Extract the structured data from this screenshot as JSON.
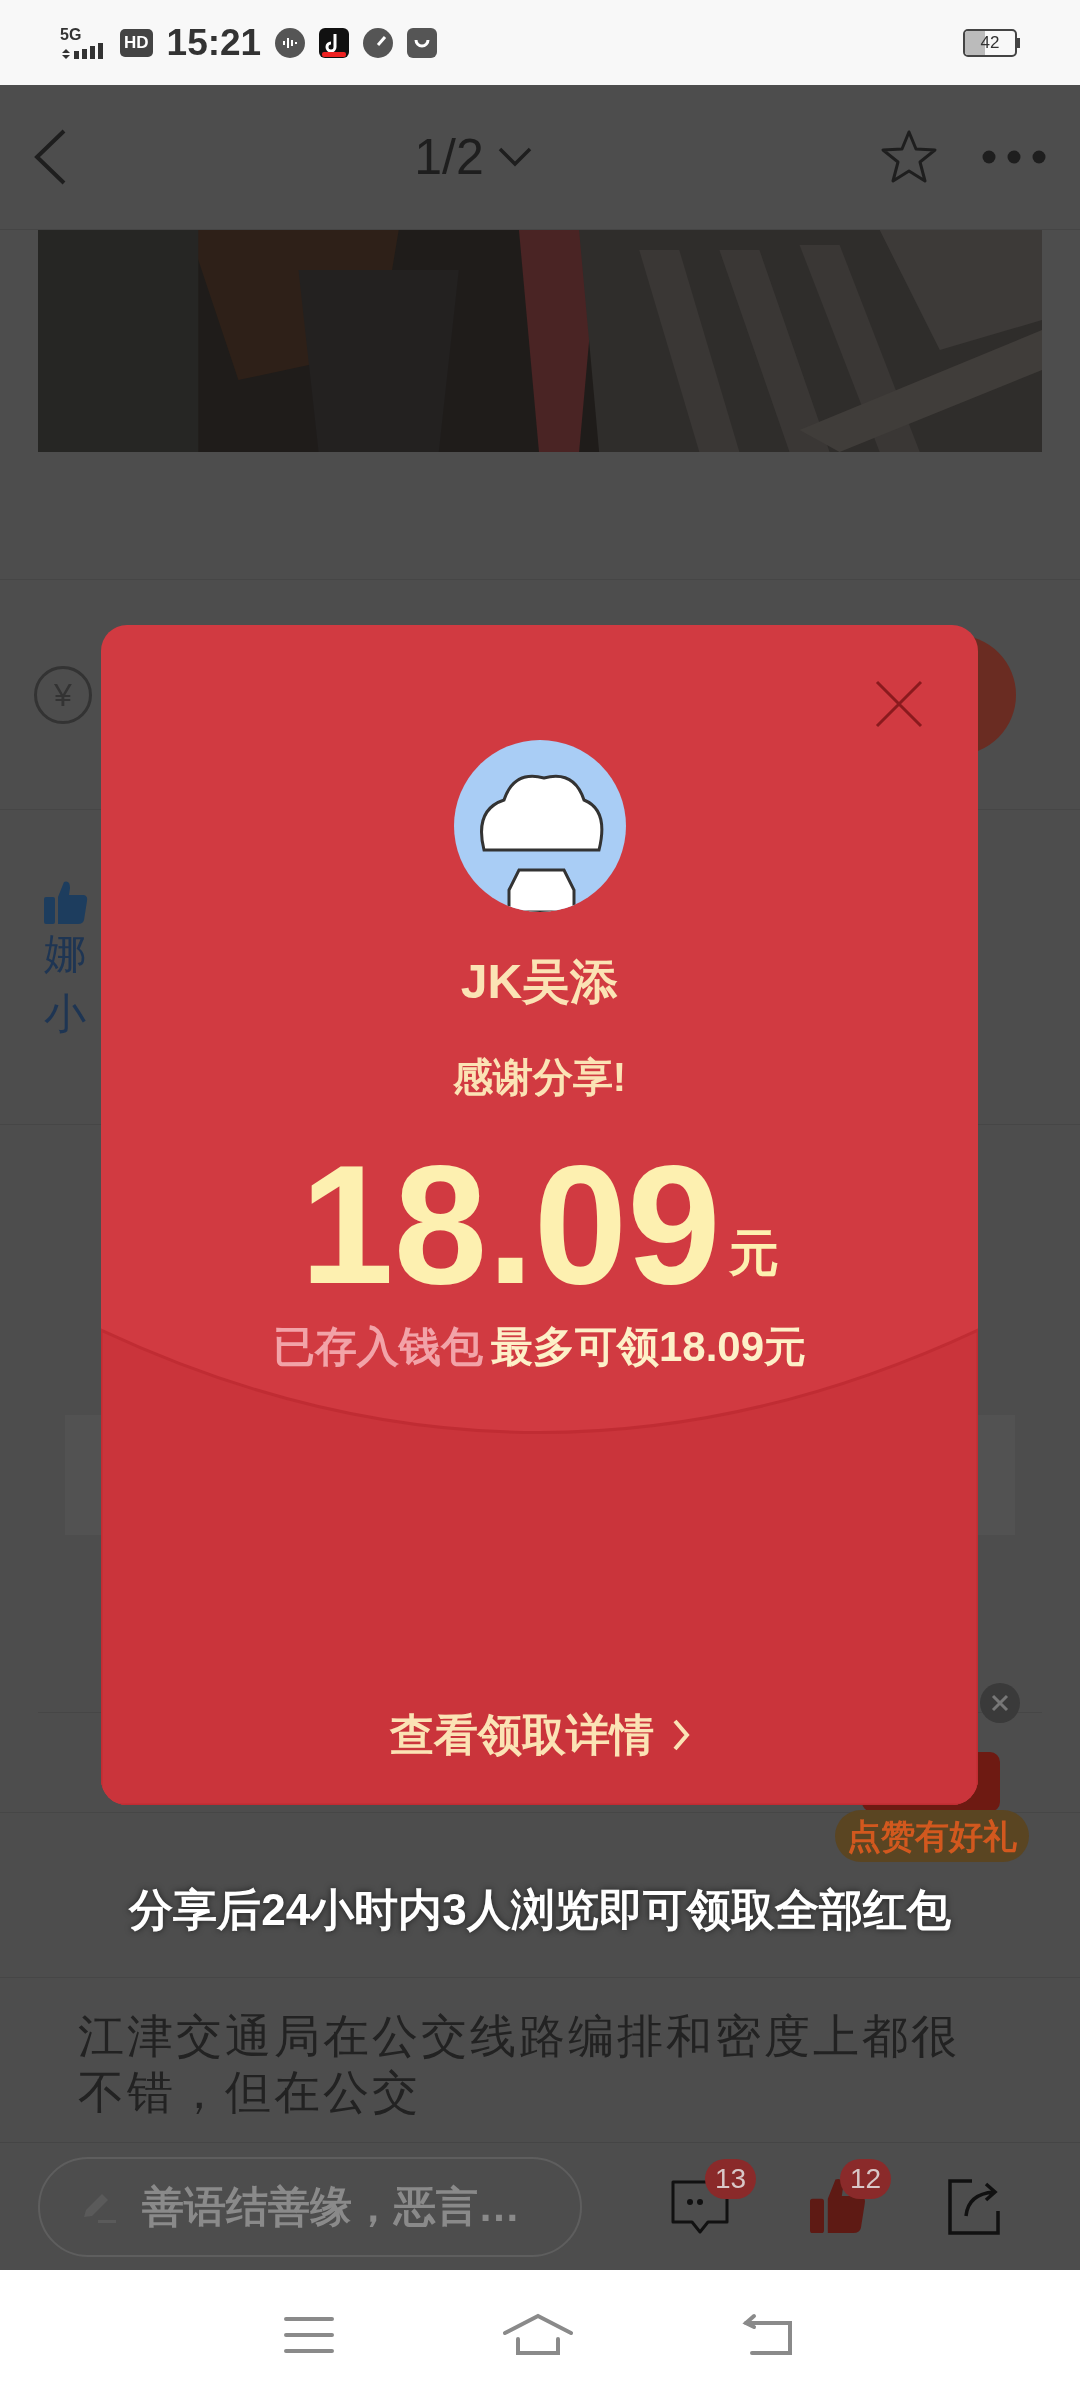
{
  "status_bar": {
    "network": "5G",
    "hd": "HD",
    "time": "15:21",
    "battery": "42"
  },
  "nav": {
    "page_indicator": "1/2"
  },
  "article": {
    "reward_icon": "¥",
    "likers": [
      "娜",
      "小"
    ],
    "paragraph": "江津交通局在公交线路编排和密度上都很不错，但在公交",
    "like_gift_badge": "点赞有好礼"
  },
  "comment_bar": {
    "placeholder": "善语结善缘，恶言…",
    "comment_count": "13",
    "like_count": "12",
    "liked": true
  },
  "red_packet": {
    "sender": "JK吴添",
    "message": "感谢分享!",
    "amount": "18.09",
    "unit": "元",
    "saved_note": "已存入钱包",
    "max_note": "最多可领18.09元",
    "details_link": "查看领取详情"
  },
  "share_tip": "分享后24小时内3人浏览即可领取全部红包"
}
